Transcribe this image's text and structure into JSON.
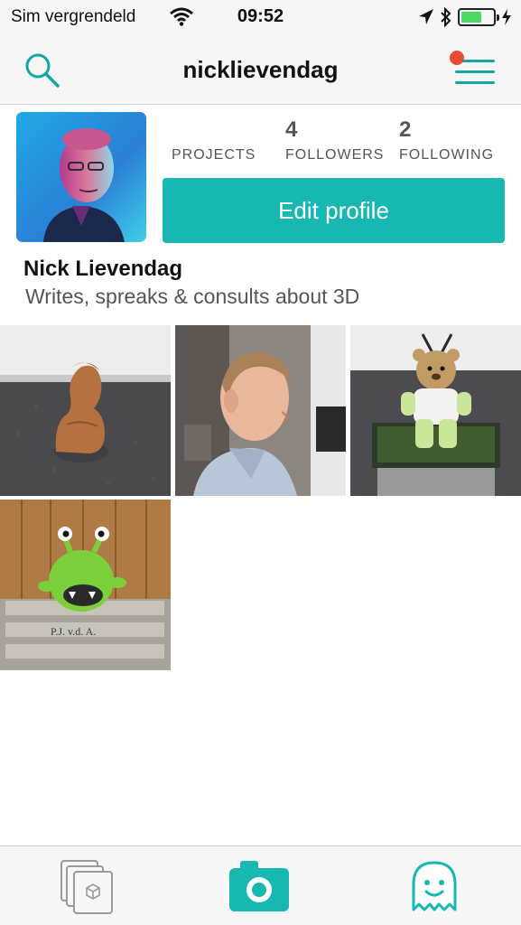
{
  "status_bar": {
    "carrier": "Sim vergrendeld",
    "time": "09:52",
    "battery_level": 0.65,
    "battery_color": "#4cd964"
  },
  "nav": {
    "title": "nicklievendag",
    "search_icon": "search-icon",
    "menu_icon": "hamburger-menu-icon",
    "notification_color": "#ea4b33"
  },
  "profile": {
    "stats": [
      {
        "value": "",
        "label": "PROJECTS"
      },
      {
        "value": "4",
        "label": "FOLLOWERS"
      },
      {
        "value": "2",
        "label": "FOLLOWING"
      }
    ],
    "edit_button_label": "Edit profile",
    "name": "Nick Lievendag",
    "bio": "Writes, spreaks & consults about 3D"
  },
  "photos": [
    {
      "subject": "terracotta-bust-photo"
    },
    {
      "subject": "man-profile-photo"
    },
    {
      "subject": "knitted-teddy-bear-photo"
    },
    {
      "subject": "green-monster-toy-photo"
    }
  ],
  "tab_bar": {
    "tabs": [
      {
        "icon": "projects-stack-icon"
      },
      {
        "icon": "camera-icon"
      },
      {
        "icon": "ghost-profile-icon"
      }
    ]
  },
  "colors": {
    "accent": "#17b7b2",
    "accent_dark": "#15a6a3",
    "notification": "#ea4b33"
  }
}
